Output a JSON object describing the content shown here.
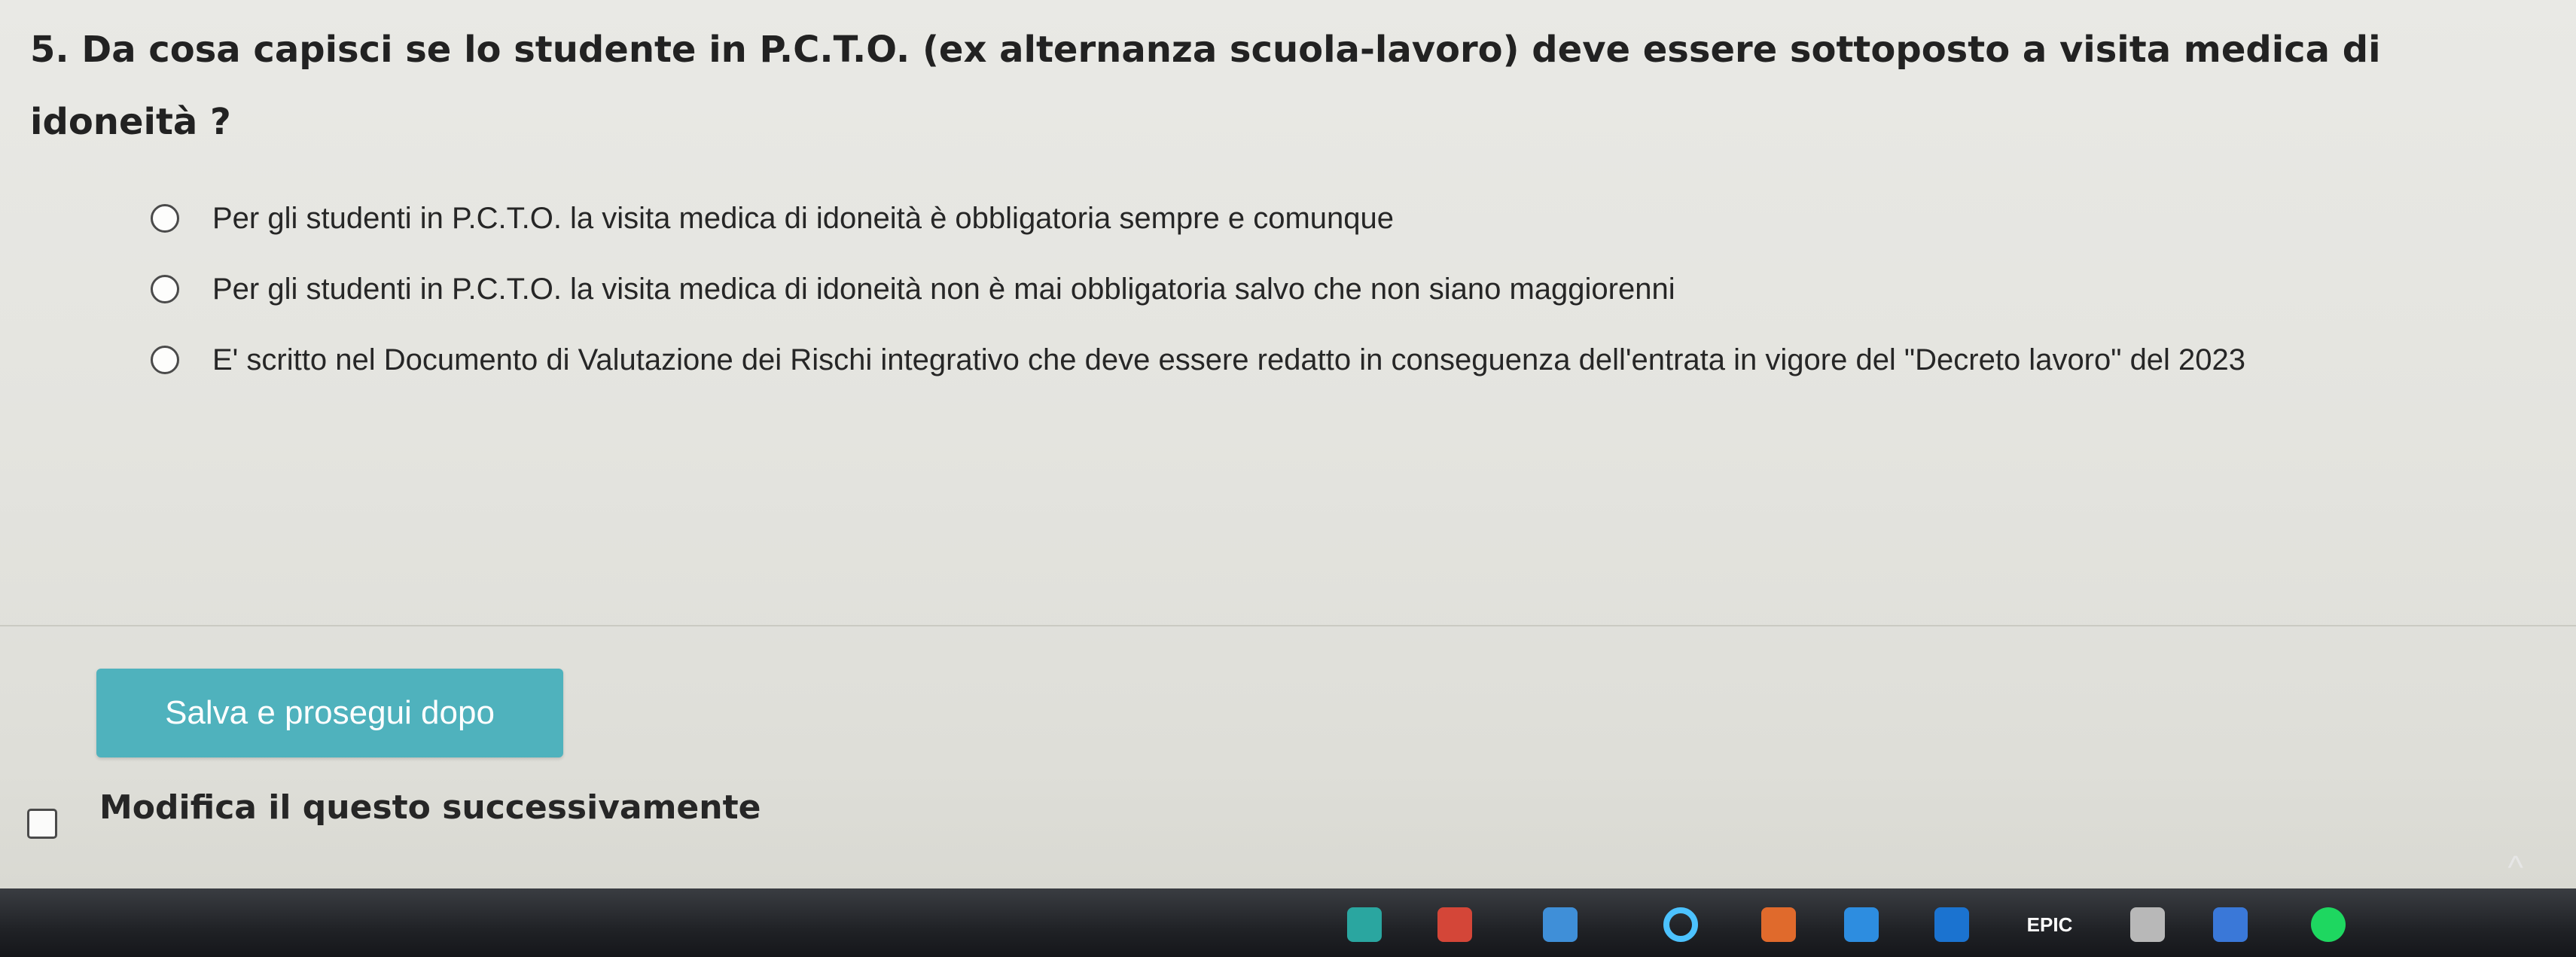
{
  "question": {
    "text": "5. Da cosa capisci se lo studente in P.C.T.O. (ex alternanza scuola-lavoro) deve essere sottoposto a visita medica di idoneità ?"
  },
  "options": [
    "Per gli studenti in P.C.T.O. la visita medica di idoneità è obbligatoria sempre e comunque",
    "Per gli studenti in P.C.T.O. la visita medica di idoneità non è mai obbligatoria salvo che non siano maggiorenni",
    "E' scritto nel Documento di Valutazione dei Rischi integrativo che deve essere redatto in conseguenza dell'entrata in vigore del \"Decreto lavoro\" del 2023"
  ],
  "save_button": {
    "label": "Salva e prosegui dopo"
  },
  "later": {
    "label": "Modifica il questo successivamente"
  },
  "taskbar": {
    "icons": [
      {
        "name": "edge-icon",
        "color": "#2aa6a0"
      },
      {
        "name": "gmail-icon",
        "color": "#d44638"
      },
      {
        "name": "store-icon",
        "color": "#3f8fd8"
      },
      {
        "name": "cortana-icon",
        "color": "#4cc2ff"
      },
      {
        "name": "office-icon",
        "color": "#e06a2c"
      },
      {
        "name": "maps-icon",
        "color": "#2d8de0"
      },
      {
        "name": "outlook-icon",
        "color": "#1b73d0"
      },
      {
        "name": "epic-games-icon",
        "color": "#ffffff",
        "label": "EPIC"
      },
      {
        "name": "controller-icon",
        "color": "#b8b8b8"
      },
      {
        "name": "rocket-league-icon",
        "color": "#3a78d8"
      },
      {
        "name": "spotify-icon",
        "color": "#1ed760"
      }
    ]
  }
}
